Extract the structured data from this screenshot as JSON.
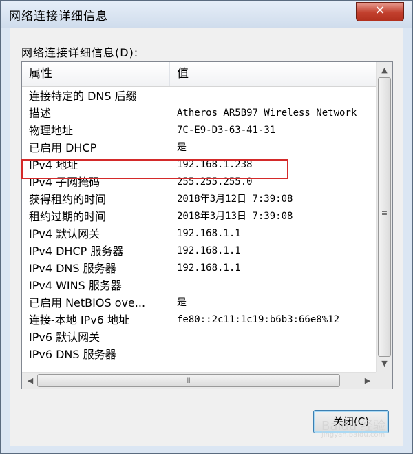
{
  "window": {
    "title": "网络连接详细信息",
    "close_glyph": "✕"
  },
  "section": {
    "label": "网络连接详细信息(D):"
  },
  "table": {
    "columns": [
      "属性",
      "值"
    ],
    "rows": [
      {
        "name": "连接特定的 DNS 后缀",
        "value": ""
      },
      {
        "name": "描述",
        "value": "Atheros AR5B97 Wireless Network"
      },
      {
        "name": "物理地址",
        "value": "7C-E9-D3-63-41-31"
      },
      {
        "name": "已启用 DHCP",
        "value": "是"
      },
      {
        "name": "IPv4 地址",
        "value": "192.168.1.238",
        "highlighted": true
      },
      {
        "name": "IPv4 子网掩码",
        "value": "255.255.255.0"
      },
      {
        "name": "获得租约的时间",
        "value": "2018年3月12日 7:39:08"
      },
      {
        "name": "租约过期的时间",
        "value": "2018年3月13日 7:39:08"
      },
      {
        "name": "IPv4 默认网关",
        "value": "192.168.1.1"
      },
      {
        "name": "IPv4 DHCP 服务器",
        "value": "192.168.1.1"
      },
      {
        "name": "IPv4 DNS 服务器",
        "value": "192.168.1.1"
      },
      {
        "name": "IPv4 WINS 服务器",
        "value": ""
      },
      {
        "name": "已启用 NetBIOS ove...",
        "value": "是"
      },
      {
        "name": "连接-本地 IPv6 地址",
        "value": "fe80::2c11:1c19:b6b3:66e8%12"
      },
      {
        "name": "IPv6 默认网关",
        "value": ""
      },
      {
        "name": "IPv6 DNS 服务器",
        "value": ""
      }
    ]
  },
  "scrollbars": {
    "up": "▲",
    "down": "▼",
    "left": "◀",
    "right": "▶",
    "v_grip": "≡",
    "h_grip": "⦀"
  },
  "buttons": {
    "close_label": "关闭(C)"
  },
  "watermark": {
    "text": "Baidu 经验",
    "sub": "jingyan.baidu.com"
  },
  "colors": {
    "highlight_border": "#d42a2a",
    "titlebar": "#dbe6f3",
    "close_button": "#c2402e"
  }
}
